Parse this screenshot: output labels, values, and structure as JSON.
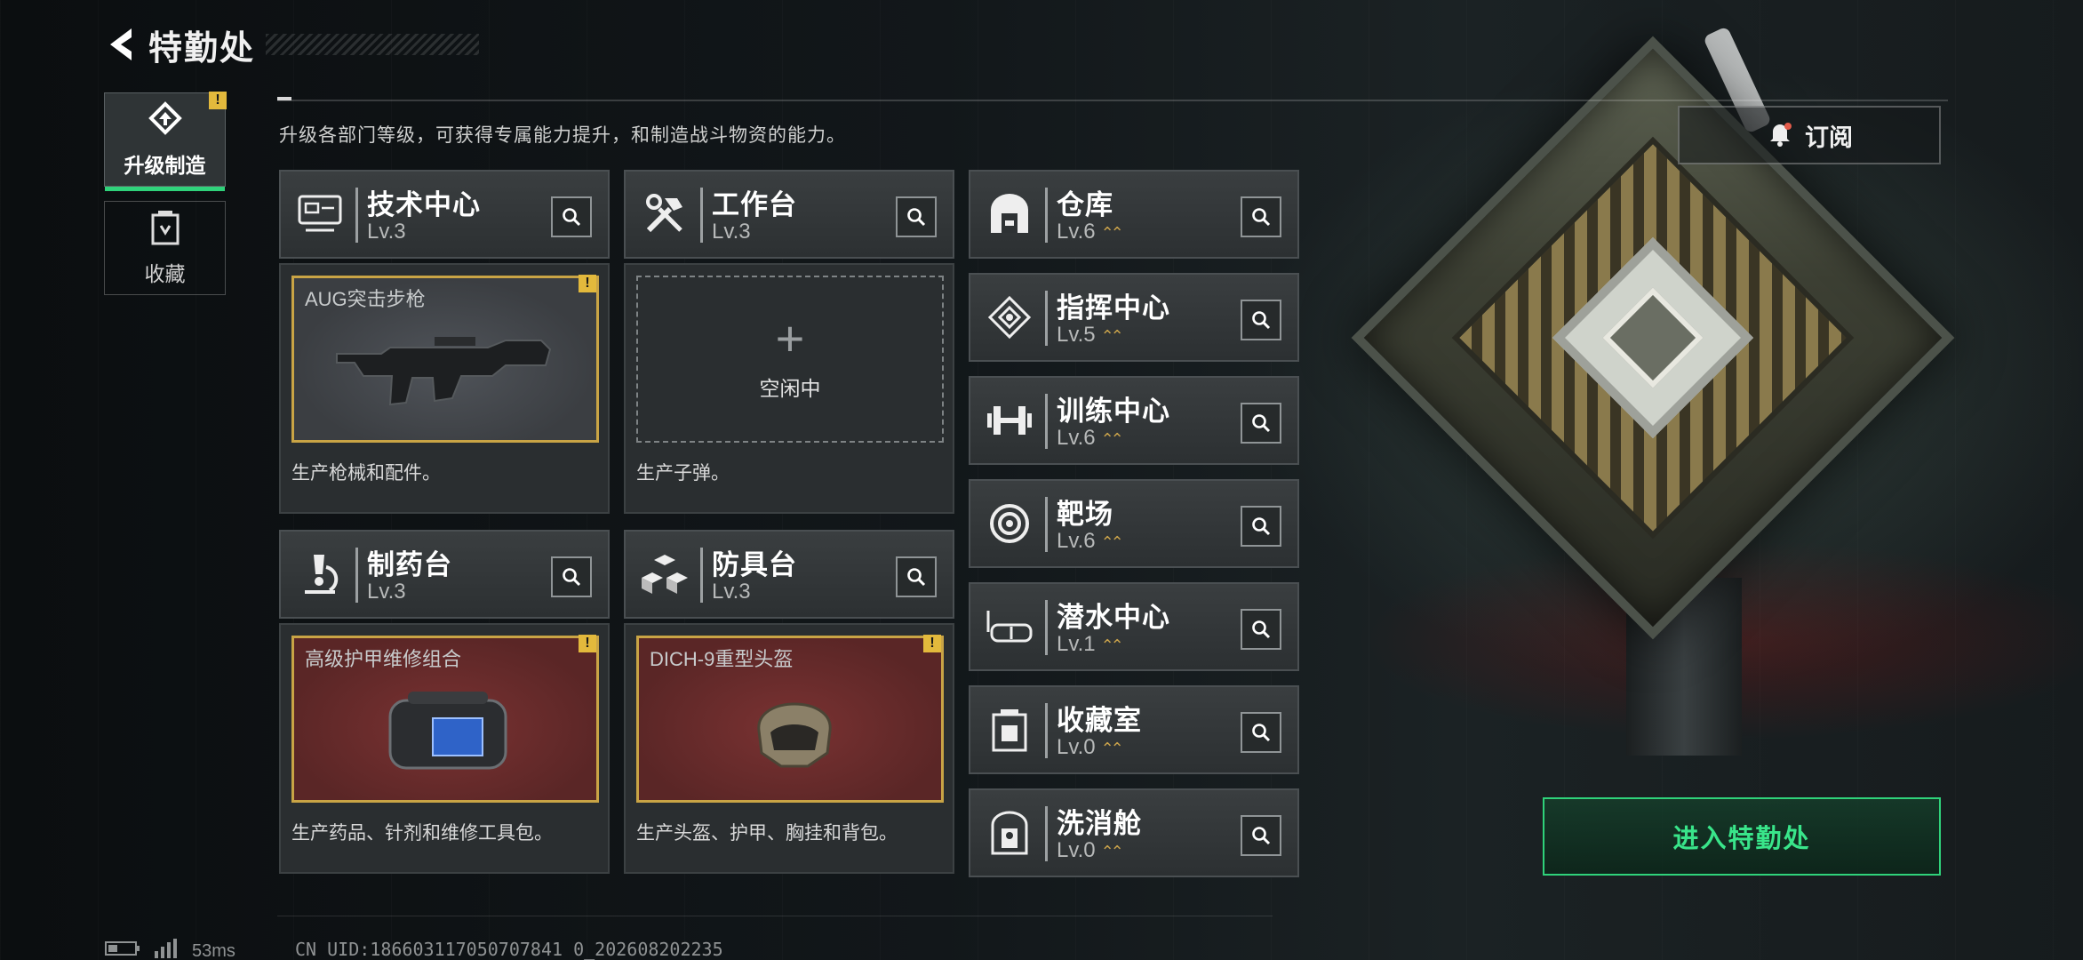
{
  "header": {
    "title": "特勤处"
  },
  "sidebar": {
    "items": [
      {
        "label": "升级制造",
        "active": true,
        "badge": "!"
      },
      {
        "label": "收藏",
        "active": false
      }
    ]
  },
  "description": "升级各部门等级，可获得专属能力提升，和制造战斗物资的能力。",
  "subscribe_label": "订阅",
  "departments": [
    {
      "name": "技术中心",
      "level": "Lv.3",
      "icon": "monitor-icon"
    },
    {
      "name": "工作台",
      "level": "Lv.3",
      "icon": "tools-icon"
    },
    {
      "name": "制药台",
      "level": "Lv.3",
      "icon": "microscope-icon"
    },
    {
      "name": "防具台",
      "level": "Lv.3",
      "icon": "cubes-icon"
    },
    {
      "name": "仓库",
      "level": "Lv.6",
      "icon": "warehouse-icon"
    },
    {
      "name": "指挥中心",
      "level": "Lv.5",
      "icon": "command-icon"
    },
    {
      "name": "训练中心",
      "level": "Lv.6",
      "icon": "dumbbell-icon"
    },
    {
      "name": "靶场",
      "level": "Lv.6",
      "icon": "target-icon"
    },
    {
      "name": "潜水中心",
      "level": "Lv.1",
      "icon": "diving-mask-icon"
    },
    {
      "name": "收藏室",
      "level": "Lv.0",
      "icon": "collection-icon"
    },
    {
      "name": "洗消舱",
      "level": "Lv.0",
      "icon": "decon-icon"
    }
  ],
  "production": [
    {
      "item": "AUG突击步枪",
      "desc": "生产枪械和配件。",
      "state": "filled",
      "badge": "!"
    },
    {
      "item": "",
      "idle": "空闲中",
      "desc": "生产子弹。",
      "state": "empty"
    },
    {
      "item": "高级护甲维修组合",
      "desc": "生产药品、针剂和维修工具包。",
      "state": "red",
      "badge": "!"
    },
    {
      "item": "DICH-9重型头盔",
      "desc": "生产头盔、护甲、胸挂和背包。",
      "state": "red",
      "badge": "!"
    }
  ],
  "enter_label": "进入特勤处",
  "status": {
    "ping": "53ms",
    "uid": "CN UID:186603117050707841 0_202608202235"
  },
  "colors": {
    "accent_green": "#2fd27a",
    "warning_gold": "#e3b93c",
    "level_gold": "#c9a24b"
  }
}
